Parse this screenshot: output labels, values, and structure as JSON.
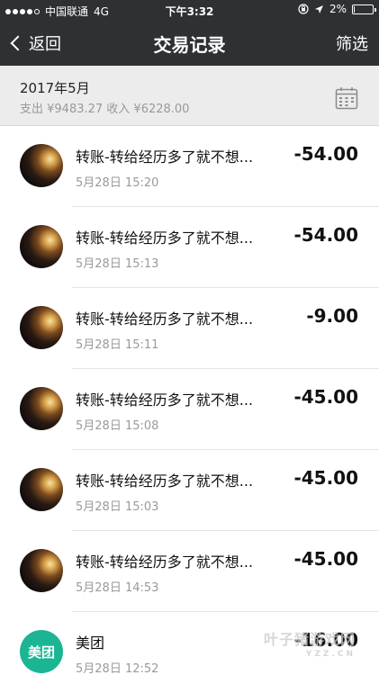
{
  "status_bar": {
    "carrier": "中国联通",
    "network": "4G",
    "time": "下午3:32",
    "battery": "2%",
    "battery_level": 0.02
  },
  "nav": {
    "back_label": "返回",
    "title": "交易记录",
    "filter_label": "筛选"
  },
  "summary": {
    "month": "2017年5月",
    "totals": "支出 ¥9483.27 收入 ¥6228.00"
  },
  "transactions": [
    {
      "name": "转账-转给经历多了就不想...",
      "time": "5月28日 15:20",
      "amount": "-54.00",
      "avatar": "photo"
    },
    {
      "name": "转账-转给经历多了就不想...",
      "time": "5月28日 15:13",
      "amount": "-54.00",
      "avatar": "photo"
    },
    {
      "name": "转账-转给经历多了就不想...",
      "time": "5月28日 15:11",
      "amount": "-9.00",
      "avatar": "photo"
    },
    {
      "name": "转账-转给经历多了就不想...",
      "time": "5月28日 15:08",
      "amount": "-45.00",
      "avatar": "photo"
    },
    {
      "name": "转账-转给经历多了就不想...",
      "time": "5月28日 15:03",
      "amount": "-45.00",
      "avatar": "photo"
    },
    {
      "name": "转账-转给经历多了就不想...",
      "time": "5月28日 14:53",
      "amount": "-45.00",
      "avatar": "photo"
    },
    {
      "name": "美团",
      "time": "5月28日 12:52",
      "amount": "-16.00",
      "avatar": "meituan",
      "avatar_text": "美团"
    }
  ],
  "watermark": {
    "text": "叶子猪游戏网",
    "sub": "YZZ.CN"
  }
}
